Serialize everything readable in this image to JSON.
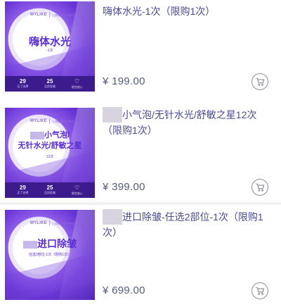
{
  "products": [
    {
      "thumb": {
        "brand_logo": "MYLIKE",
        "brand_text": "上海美莱医疗美容",
        "main_title": "嗨体水光",
        "sub_title": "-1次",
        "stats": [
          {
            "num": "29",
            "label": "买了选择"
          },
          {
            "num": "25",
            "label": "品质医美"
          },
          {
            "num": "",
            "label": "便宜放心"
          }
        ]
      },
      "title": "嗨体水光-1次（限购1次）",
      "price": "¥ 199.00"
    },
    {
      "thumb": {
        "brand_logo": "MYLIKE",
        "brand_text": "上海美莱医疗美容",
        "main_title_line1": "小气泡/",
        "main_title_line2": "无针水光/舒敏之星",
        "sub_title": "12次",
        "stats": [
          {
            "num": "29",
            "label": "买了选择"
          },
          {
            "num": "25",
            "label": "品质医美"
          },
          {
            "num": "",
            "label": "便宜放心"
          }
        ]
      },
      "title_blurred": "超值",
      "title": "小气泡/无针水光/舒敏之星12次（限购1次）",
      "price": "¥ 399.00"
    },
    {
      "thumb": {
        "brand_logo": "MYLIKE",
        "brand_text": "上海美莱医疗美容",
        "main_title": "进口除皱",
        "sub_title": "任选2部位-1次（限购1次）",
        "stats": [
          {
            "num": "",
            "label": ""
          }
        ]
      },
      "title_blurred": "国产",
      "title": "进口除皱-任选2部位-1次（限购1次）",
      "price": "¥ 699.00"
    }
  ]
}
